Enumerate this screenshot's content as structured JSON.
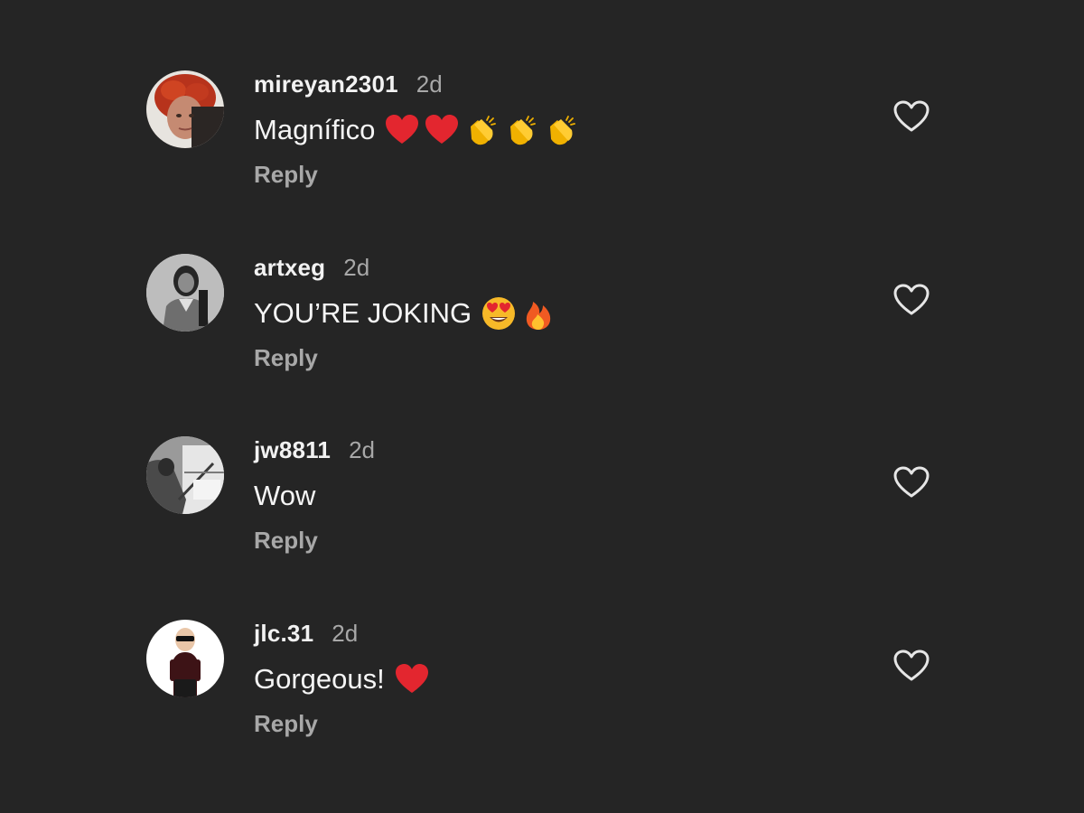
{
  "comments": [
    {
      "username": "mireyan2301",
      "time": "2d",
      "text": "Magnífico",
      "emojis": [
        "red-heart-emoji",
        "red-heart-emoji",
        "clapping-hands-emoji",
        "clapping-hands-emoji",
        "clapping-hands-emoji"
      ],
      "reply_label": "Reply",
      "liked": false
    },
    {
      "username": "artxeg",
      "time": "2d",
      "text": "YOU’RE JOKING",
      "emojis": [
        "heart-eyes-emoji",
        "fire-emoji"
      ],
      "reply_label": "Reply",
      "liked": false
    },
    {
      "username": "jw8811",
      "time": "2d",
      "text": "Wow",
      "emojis": [],
      "reply_label": "Reply",
      "liked": false
    },
    {
      "username": "jlc.31",
      "time": "2d",
      "text": "Gorgeous!",
      "emojis": [
        "red-heart-emoji"
      ],
      "reply_label": "Reply",
      "liked": false
    }
  ],
  "colors": {
    "background": "#252525",
    "username": "#f2f2f2",
    "secondary_text": "#a8a8a8",
    "heart_emoji": "#e3262f",
    "like_outline": "#e6e6e6"
  }
}
